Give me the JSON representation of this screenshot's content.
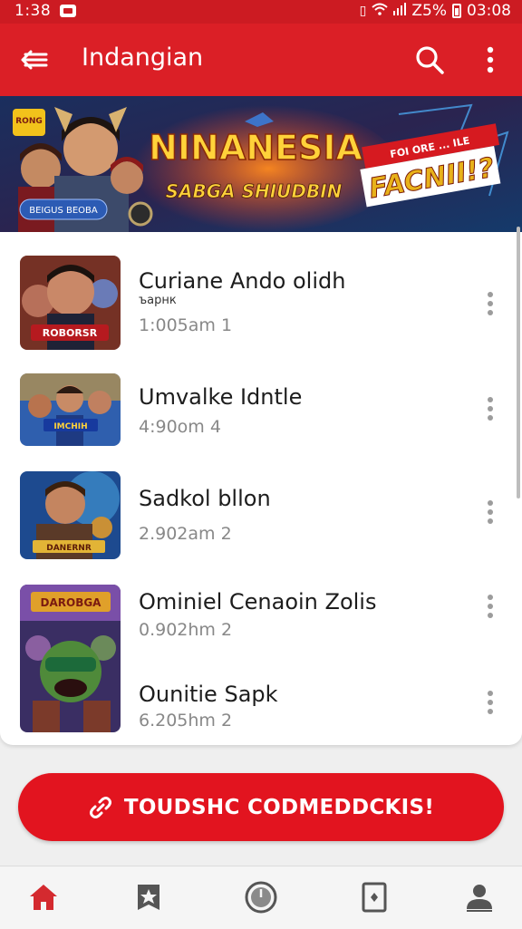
{
  "status_bar": {
    "time": "1:38",
    "battery_text": "Z5%",
    "clock_right": "03:08"
  },
  "app_bar": {
    "title": "Indangian"
  },
  "banner": {
    "top_left_badge": "RONG",
    "headline": "NINANESIA",
    "subheadline": "SABGA SHIUDBIN",
    "button_label": "BEIGUS BEOBA",
    "promo_small": "FOI ORE ... ILE",
    "promo_big": "FACNII!?"
  },
  "list": {
    "items": [
      {
        "name": "Curiane Ando olidh",
        "sub": "ъарнк",
        "meta": "1:005am 1"
      },
      {
        "name": "Umvalke Idntle",
        "sub": "",
        "meta": "4:90om 4"
      },
      {
        "name": "Sadkol bllon",
        "sub": "",
        "meta": "2.902am 2"
      },
      {
        "name": "Ominiel Cenaoin Zolis",
        "sub": "",
        "meta": "0.902hm 2"
      },
      {
        "name": "Ounitie Sapk",
        "sub": "",
        "meta": "6.205hm 2"
      }
    ],
    "thumb_labels": [
      "ROBORSR",
      "IMCHIH",
      "DANERNR",
      "DAROBGA"
    ]
  },
  "cta": {
    "label": "TOUDSHC CODMEDDCKIS!"
  },
  "colors": {
    "brand_red": "#db1f26",
    "status_red": "#cc1b22",
    "cta_red": "#e2141f",
    "nav_active": "#d42a2f",
    "nav_inactive": "#555555"
  },
  "bottom_nav": {
    "items": [
      "home-icon",
      "star-badge-icon",
      "clock-icon",
      "card-icon",
      "profile-icon"
    ]
  }
}
